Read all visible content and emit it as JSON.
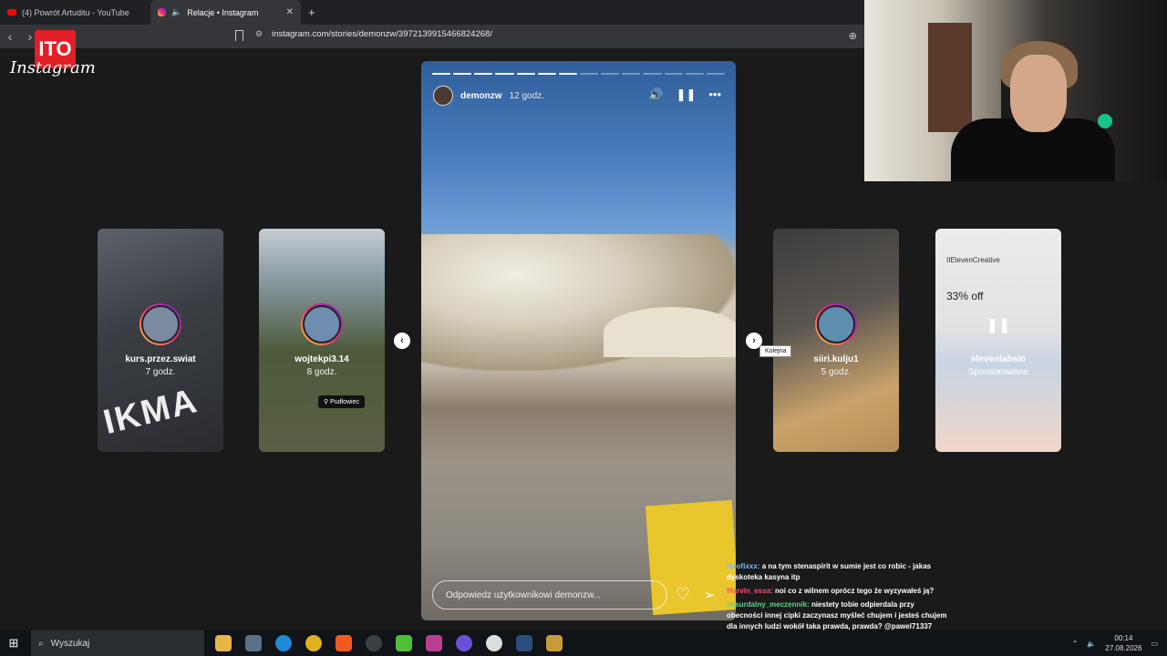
{
  "browser": {
    "tabs": [
      {
        "title": "(4) Powrót Artuditu - YouTube"
      },
      {
        "title": "Relacje • Instagram"
      }
    ],
    "url": "instagram.com/stories/demonzw/3972139915466824268/"
  },
  "overlay_logo": "ITO",
  "instagram": {
    "logo": "Instagram",
    "main_story": {
      "username": "demonzw",
      "time": "12 godz.",
      "reply_placeholder": "Odpowiedz użytkownikowi demonzw...",
      "progress_total": 14,
      "progress_done": 7
    },
    "side_stories": [
      {
        "username": "kurs.przez.swiat",
        "time": "7 godz."
      },
      {
        "username": "wojtekpi3.14",
        "time": "8 godz.",
        "location": "Pudłowiec"
      },
      {
        "username": "siiri.kulju1",
        "time": "5 godz."
      },
      {
        "username": "elevenlabsio",
        "time": "Sponsorowane",
        "brand": "IIElevenCreative",
        "promo": "33% off"
      }
    ],
    "next_tooltip": "Kolejna"
  },
  "chat": [
    {
      "user": "Hoofixxx:",
      "text": "a na tym stenaspirit w sumie jest co robic - jakas dyskoteka kasyna itp"
    },
    {
      "user": "Marvin_essa:",
      "text": "noi co z wilnem oprócz tego że wyzywałeś ją?"
    },
    {
      "user": "absurdalny_meczennik:",
      "text": "niestety tobie odpierdala przy obecności innej cipki zaczynasz myśleć chujem i jesteś chujem dla innych ludzi wokół taka prawda, prawda? @pawel71337"
    }
  ],
  "taskbar": {
    "search_placeholder": "Wyszukaj",
    "time": "00:14",
    "date": "27.08.2026"
  }
}
